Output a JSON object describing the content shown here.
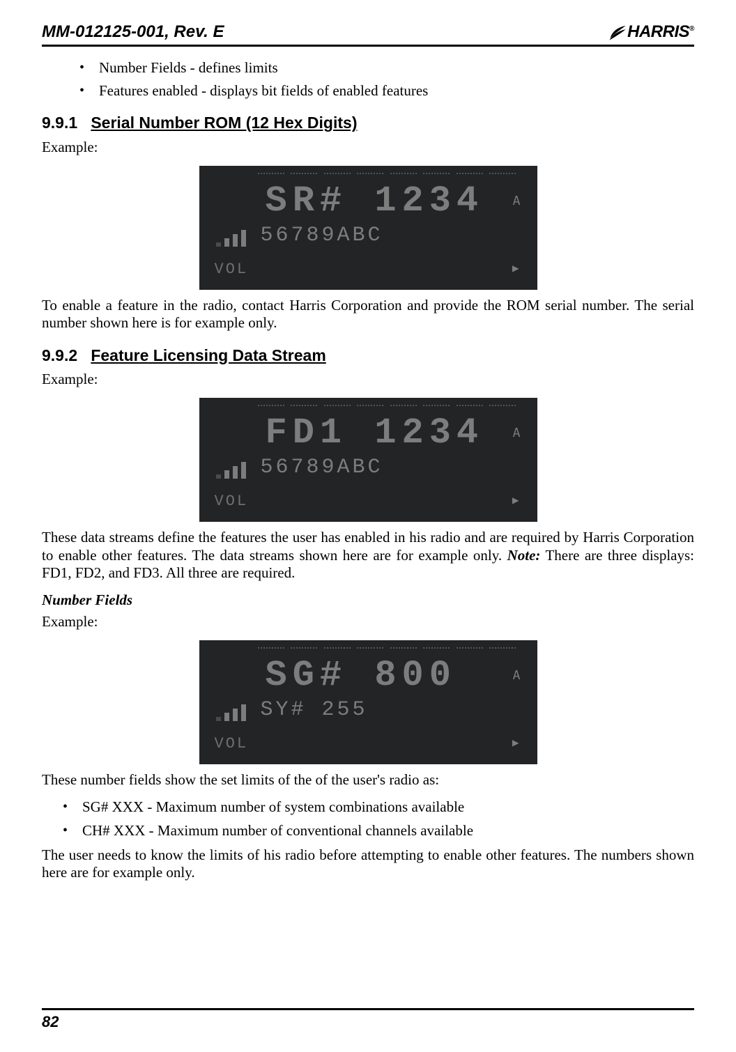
{
  "header": {
    "doc_id": "MM-012125-001, Rev. E",
    "logo_text": "ARRIS",
    "logo_reg": "®"
  },
  "intro_bullets": [
    "Number Fields - defines limits",
    "Features enabled - displays bit fields of enabled features"
  ],
  "sec_991": {
    "num": "9.9.1",
    "title": "Serial Number ROM (12 Hex Digits)",
    "example_label": "Example:",
    "lcd": {
      "line1": "SR# 1234",
      "line2": "56789ABC",
      "indicator": "A",
      "vol": "VOL",
      "arrow": "▶"
    },
    "para": "To enable a feature in the radio, contact Harris Corporation and provide the ROM serial number. The serial number shown here is for example only."
  },
  "sec_992": {
    "num": "9.9.2",
    "title": "Feature Licensing Data Stream",
    "example_label": "Example:",
    "lcd": {
      "line1": "FD1 1234",
      "line2": "56789ABC",
      "indicator": "A",
      "vol": "VOL",
      "arrow": "▶"
    },
    "para_before_note": "These data streams define the features the user has enabled in his radio and are required by Harris Corporation to enable other features. The data streams shown here are for example only. ",
    "note_label": "Note:",
    "para_after_note": " There are three displays: FD1, FD2, and FD3. All three are required."
  },
  "number_fields": {
    "heading": "Number Fields",
    "example_label": "Example:",
    "lcd": {
      "line1": "SG# 800",
      "line2": "SY# 255",
      "indicator": "A",
      "vol": "VOL",
      "arrow": "▶"
    },
    "intro": "These number fields show the set limits of the of the user's radio as:",
    "bullets": [
      "SG# XXX - Maximum number of system combinations available",
      "CH# XXX - Maximum number of conventional channels available"
    ],
    "outro": "The user needs to know the limits of his radio before attempting to enable other features. The numbers shown here are for example only."
  },
  "footer": {
    "page": "82"
  }
}
